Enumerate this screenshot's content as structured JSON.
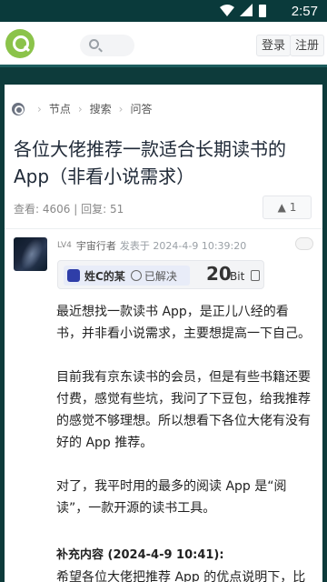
{
  "status_bar": {
    "time": "2:57",
    "icons": [
      "wifi-icon",
      "signal-icon",
      "battery-icon"
    ]
  },
  "header": {
    "login": "登录",
    "register": "注册"
  },
  "breadcrumb": [
    "节点",
    "搜索",
    "问答"
  ],
  "post": {
    "title": "各位大佬推荐一款适合长期读书的App（非看小说需求）",
    "views": "查看: 4606",
    "replies": "回复: 51",
    "votes": "1"
  },
  "author": {
    "level": "LV4",
    "name": "宇宙行者",
    "posted": "发表于 2024-4-9 10:39:20"
  },
  "bounty": {
    "solver": "姓C的某",
    "status": "已解决",
    "amount": "20",
    "unit": "Bit"
  },
  "content": {
    "p1": "最近想找一款读书 App，是正儿八经的看书，并非看小说需求，主要想提高一下自己。",
    "p2": "目前我有京东读书的会员，但是有些书籍还要付费，感觉有些坑，我问了下豆包，给我推荐的感觉不够理想。所以想看下各位大佬有没有好的 App 推荐。",
    "p3": "对了，我平时用的最多的阅读 App 是“阅读”，一款开源的读书工具。",
    "supplement_title": "补充内容 (2024-4-9 10:41):",
    "supplement_text": "希望各位大佬把推荐 App 的优点说明下，比"
  },
  "colors": {
    "header_bg": "#0a3a3b",
    "accent": "#8bc34a"
  }
}
